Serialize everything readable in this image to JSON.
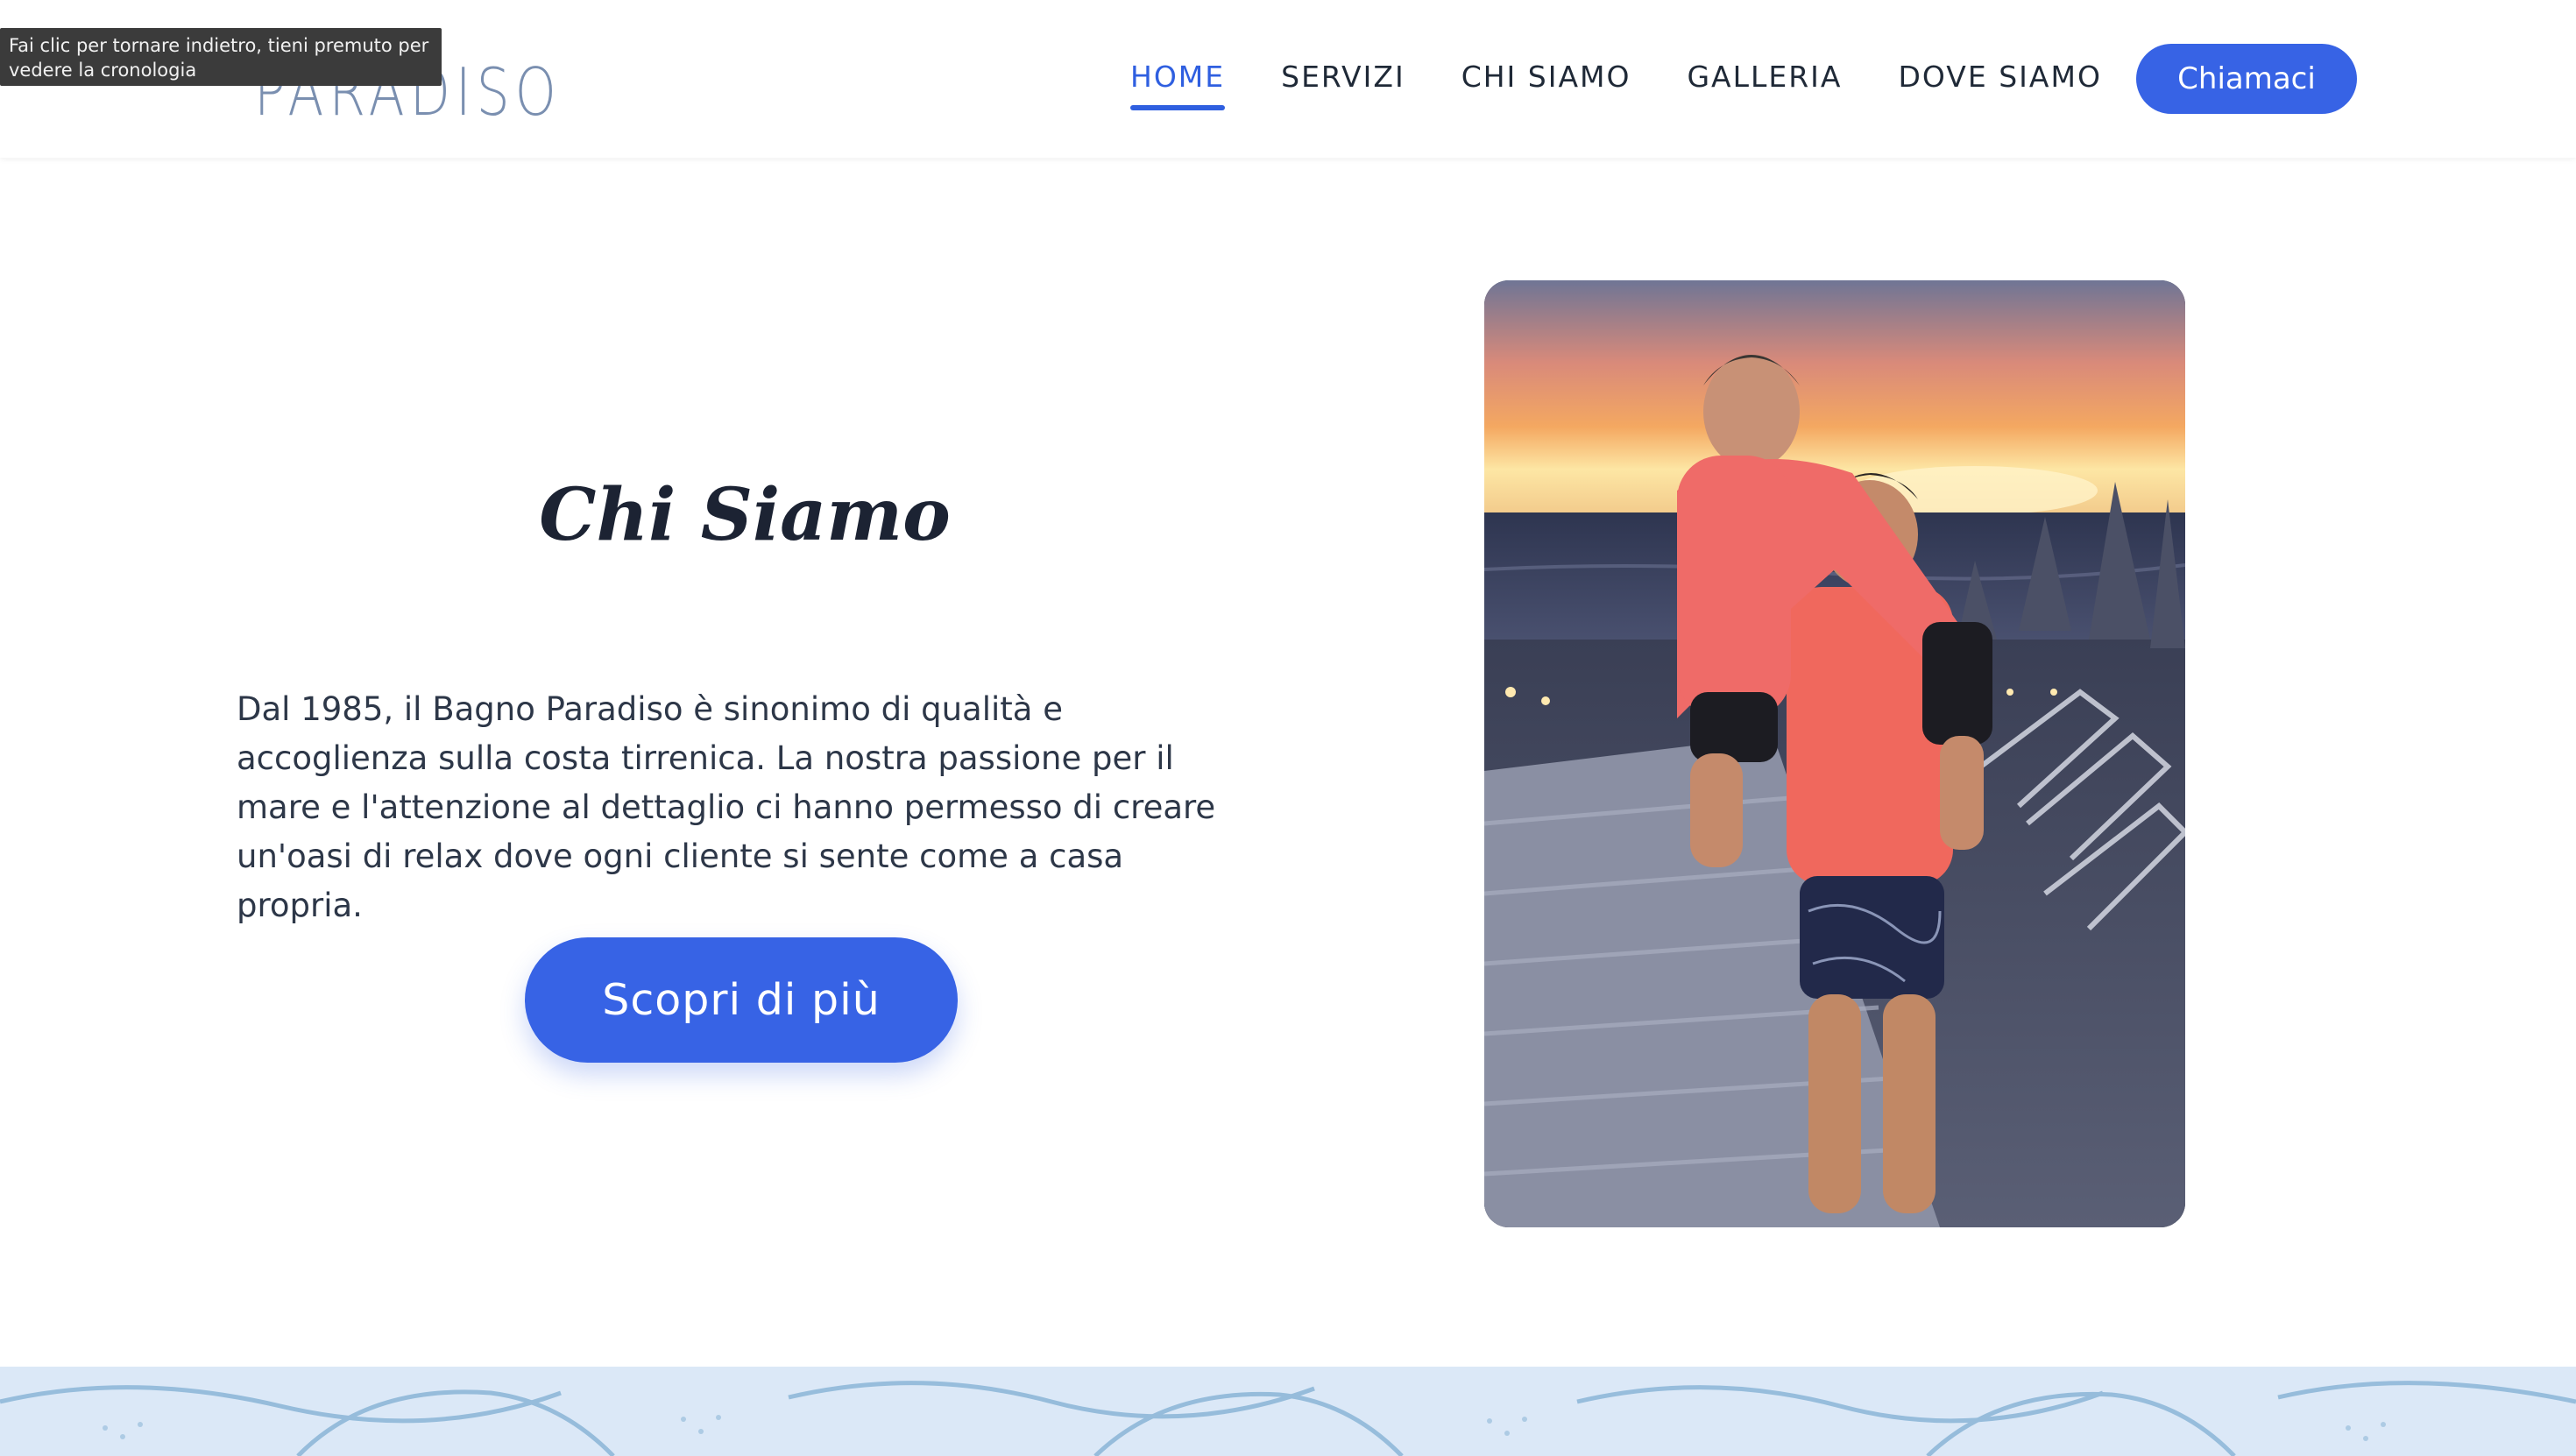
{
  "browser": {
    "back_tooltip_line1": "Fai clic per tornare indietro, tieni premuto per",
    "back_tooltip_line2": "vedere la cronologia"
  },
  "header": {
    "logo_text": "PARADISO",
    "nav": [
      {
        "label": "HOME",
        "active": true
      },
      {
        "label": "SERVIZI",
        "active": false
      },
      {
        "label": "CHI SIAMO",
        "active": false
      },
      {
        "label": "GALLERIA",
        "active": false
      },
      {
        "label": "DOVE SIAMO",
        "active": false
      }
    ],
    "cta_label": "Chiamaci"
  },
  "about": {
    "title": "Chi Siamo",
    "body": "Dal 1985, il Bagno Paradiso è sinonimo di qualità e accoglienza sulla costa tirrenica. La nostra passione per il mare e l'attenzione al dettaglio ci hanno permesso di creare un'oasi di relax dove ogni cliente si sente come a casa propria.",
    "button_label": "Scopri di più"
  },
  "colors": {
    "accent": "#3763e5",
    "nav_active": "#2f5fe0",
    "text": "#1f2937",
    "footer_band": "#dbe8f7"
  }
}
